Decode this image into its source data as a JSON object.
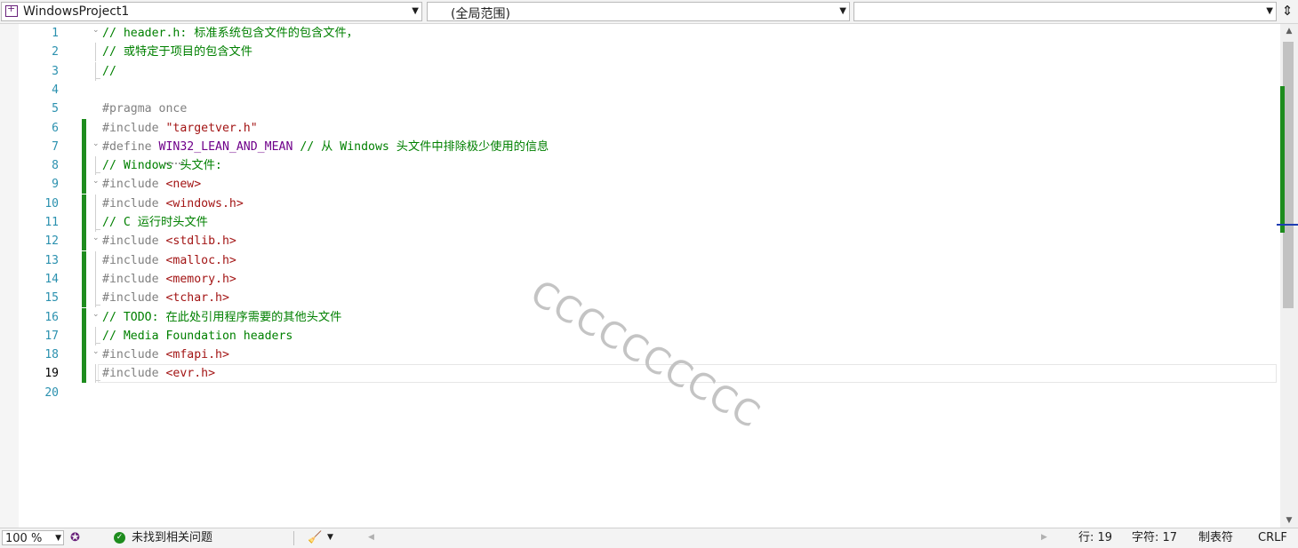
{
  "navbar": {
    "project": "WindowsProject1",
    "scope": "(全局范围)",
    "member": ""
  },
  "editor": {
    "current_line": 19,
    "lines": [
      {
        "n": "1",
        "fold": "⌄",
        "tokens": [
          {
            "t": "// header.h: 标准系统包含文件的包含文件，",
            "c": "comment"
          }
        ]
      },
      {
        "n": "2",
        "tokens": [
          {
            "t": "// 或特定于项目的包含文件",
            "c": "comment"
          }
        ]
      },
      {
        "n": "3",
        "tokens": [
          {
            "t": "//",
            "c": "comment"
          }
        ]
      },
      {
        "n": "4",
        "tokens": []
      },
      {
        "n": "5",
        "tokens": [
          {
            "t": "#pragma once",
            "c": "pre"
          }
        ]
      },
      {
        "n": "6",
        "changed": true,
        "tokens": [
          {
            "t": "#include ",
            "c": "pre"
          },
          {
            "t": "\"targetver.h\"",
            "c": "str"
          }
        ]
      },
      {
        "n": "7",
        "changed": true,
        "fold": "⌄",
        "tokens": [
          {
            "t": "#define ",
            "c": "pre"
          },
          {
            "t": "WIN32_LEAN_AND_MEAN",
            "c": "macro"
          },
          {
            "t": " // 从 Windows 头文件中排除极少使用的信息",
            "c": "comment"
          }
        ]
      },
      {
        "n": "8",
        "changed": true,
        "tokens": [
          {
            "t": "// Windows 头文件:",
            "c": "comment"
          }
        ]
      },
      {
        "n": "9",
        "changed": true,
        "fold": "⌄",
        "tokens": [
          {
            "t": "#include ",
            "c": "pre"
          },
          {
            "t": "<new>",
            "c": "str"
          }
        ]
      },
      {
        "n": "10",
        "changed": true,
        "tokens": [
          {
            "t": "#include ",
            "c": "pre"
          },
          {
            "t": "<windows.h>",
            "c": "str"
          }
        ]
      },
      {
        "n": "11",
        "changed": true,
        "tokens": [
          {
            "t": "// C 运行时头文件",
            "c": "comment"
          }
        ]
      },
      {
        "n": "12",
        "changed": true,
        "fold": "⌄",
        "tokens": [
          {
            "t": "#include ",
            "c": "pre"
          },
          {
            "t": "<stdlib.h>",
            "c": "str"
          }
        ]
      },
      {
        "n": "13",
        "changed": true,
        "tokens": [
          {
            "t": "#include ",
            "c": "pre"
          },
          {
            "t": "<malloc.h>",
            "c": "str"
          }
        ]
      },
      {
        "n": "14",
        "changed": true,
        "tokens": [
          {
            "t": "#include ",
            "c": "pre"
          },
          {
            "t": "<memory.h>",
            "c": "str"
          }
        ]
      },
      {
        "n": "15",
        "changed": true,
        "tokens": [
          {
            "t": "#include ",
            "c": "pre"
          },
          {
            "t": "<tchar.h>",
            "c": "str"
          }
        ]
      },
      {
        "n": "16",
        "changed": true,
        "fold": "⌄",
        "tokens": [
          {
            "t": "// TODO: 在此处引用程序需要的其他头文件",
            "c": "comment"
          }
        ]
      },
      {
        "n": "17",
        "changed": true,
        "tokens": [
          {
            "t": "// Media Foundation headers",
            "c": "comment"
          }
        ]
      },
      {
        "n": "18",
        "changed": true,
        "fold": "⌄",
        "tokens": [
          {
            "t": "#include ",
            "c": "pre"
          },
          {
            "t": "<mfapi.h>",
            "c": "str"
          }
        ]
      },
      {
        "n": "19",
        "changed": true,
        "tokens": [
          {
            "t": "#include ",
            "c": "pre"
          },
          {
            "t": "<evr.h>",
            "c": "str"
          }
        ]
      },
      {
        "n": "20",
        "tokens": []
      }
    ],
    "watermark": "CCCCCCCCCC"
  },
  "statusbar": {
    "zoom": "100 %",
    "issues": "未找到相关问题",
    "line": "行: 19",
    "char": "字符: 17",
    "indent": "制表符",
    "eol": "CRLF"
  },
  "colors": {
    "comment": "#008000",
    "preprocessor": "#808080",
    "string": "#a31515",
    "macro": "#6f008a",
    "line_number": "#2b91af",
    "change_bar": "#1e8c1e"
  },
  "icons": {
    "project": "project-icon",
    "split": "split-window-icon",
    "ok": "check-circle-icon",
    "cleanup": "broom-icon"
  }
}
